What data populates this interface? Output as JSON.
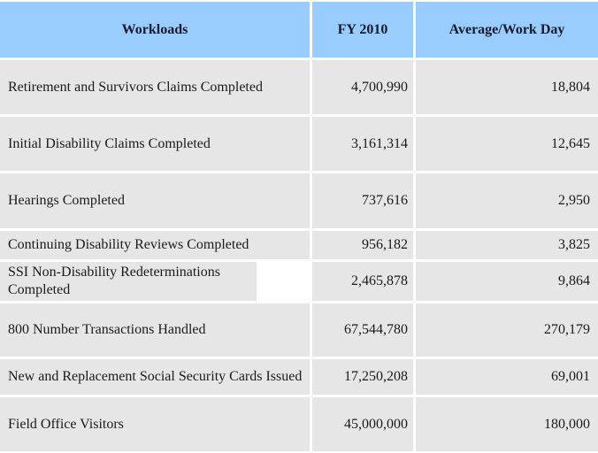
{
  "table": {
    "headers": [
      "Workloads",
      "FY 2010",
      "Average/Work Day"
    ],
    "header_color": "#99ccff",
    "row_color": "#e6e6e6",
    "rows": [
      {
        "workload": "Retirement and Survivors Claims Completed",
        "fy2010": "4,700,990",
        "avg": "18,804"
      },
      {
        "workload": "Initial Disability Claims Completed",
        "fy2010": "3,161,314",
        "avg": "12,645"
      },
      {
        "workload": "Hearings Completed",
        "fy2010": "737,616",
        "avg": "2,950"
      },
      {
        "workload": "Continuing Disability Reviews Completed",
        "fy2010": "956,182",
        "avg": "3,825"
      },
      {
        "workload": "SSI Non-Disability Redeterminations Completed",
        "fy2010": "2,465,878",
        "avg": "9,864"
      },
      {
        "workload": "800 Number Transactions Handled",
        "fy2010": "67,544,780",
        "avg": "270,179"
      },
      {
        "workload": "New and Replacement Social Security Cards Issued",
        "fy2010": "17,250,208",
        "avg": "69,001"
      },
      {
        "workload": "Field Office Visitors",
        "fy2010": "45,000,000",
        "avg": "180,000"
      }
    ]
  }
}
